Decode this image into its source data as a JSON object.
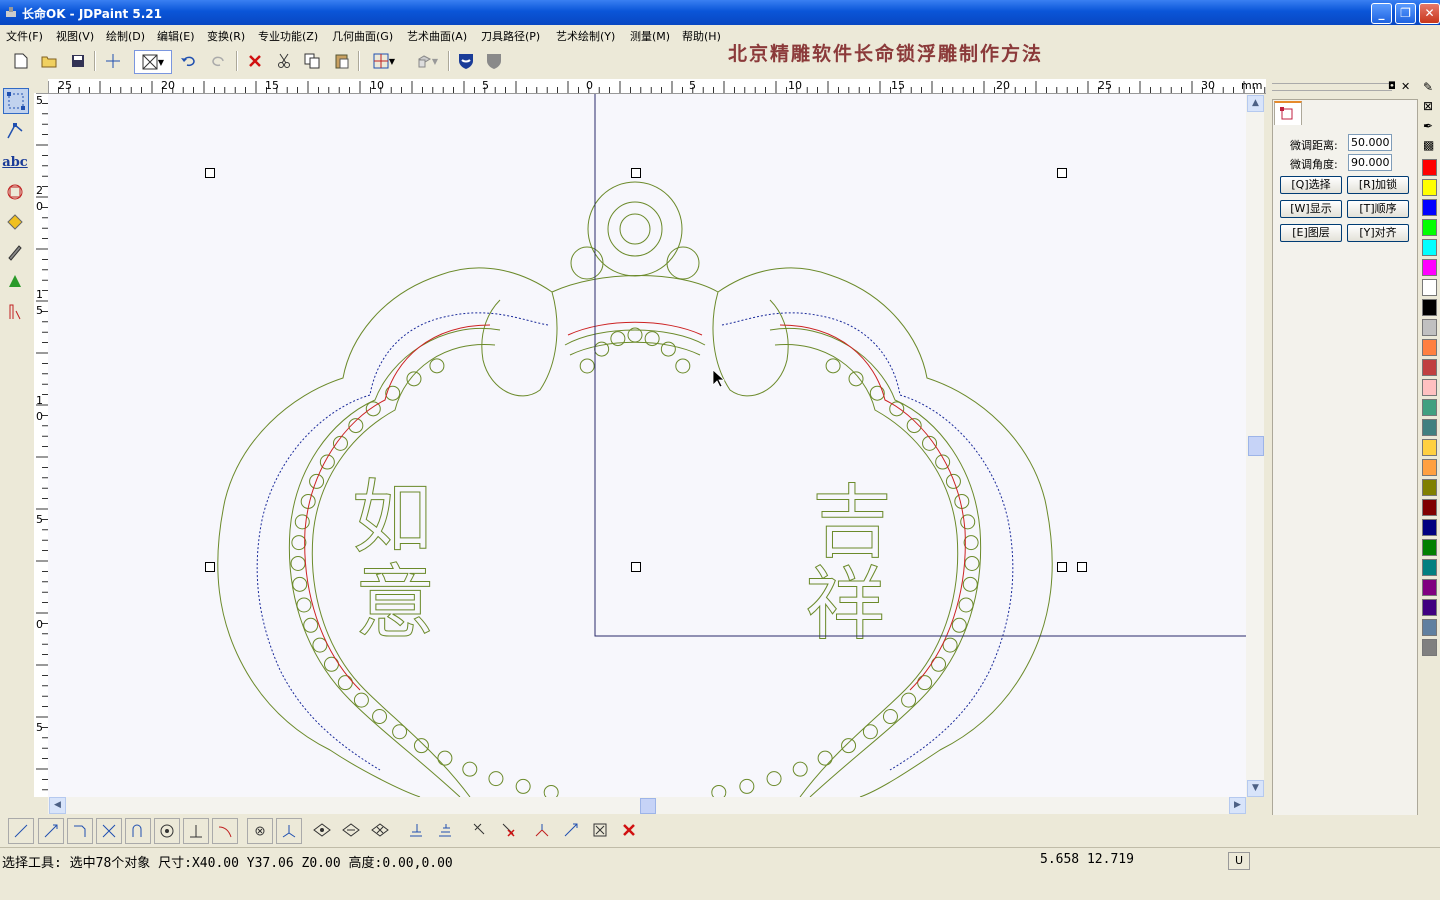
{
  "window": {
    "title": "长命OK - JDPaint 5.21",
    "minimize": "_",
    "maximize": "❐",
    "close": "✕"
  },
  "menu": [
    "文件(F)",
    "视图(V)",
    "绘制(D)",
    "编辑(E)",
    "变换(R)",
    "专业功能(Z)",
    "几何曲面(G)",
    "艺术曲面(A)",
    "刀具路径(P)",
    "艺术绘制(Y)",
    "测量(M)",
    "帮助(H)"
  ],
  "headline": "北京精雕软件长命锁浮雕制作方法",
  "ruler": {
    "h_labels": [
      "25",
      "20",
      "15",
      "10",
      "5",
      "0",
      "5",
      "10",
      "15",
      "20",
      "25",
      "30"
    ],
    "unit": "mm",
    "v_labels": [
      "5",
      "2\n0",
      "1\n5",
      "1\n0",
      "5",
      "0",
      "5"
    ]
  },
  "panel": {
    "dist_label": "微调距离:",
    "dist_value": "50.000",
    "angle_label": "微调角度:",
    "angle_value": "90.000",
    "buttons": [
      "[Q]选择",
      "[R]加锁",
      "[W]显示",
      "[T]顺序",
      "[E]图层",
      "[Y]对齐"
    ]
  },
  "canvas_text": {
    "left_1": "如",
    "left_2": "意",
    "right_1": "吉",
    "right_2": "祥"
  },
  "palette": [
    "#ff0000",
    "#ffff00",
    "#0000ff",
    "#00ff00",
    "#00ffff",
    "#ff00ff",
    "#ffffff",
    "#000000",
    "#c0c0c0",
    "#ff8040",
    "#c04040",
    "#ffc0c0",
    "#40a080",
    "#408080",
    "#ffd040",
    "#ffa040",
    "#808000",
    "#800000",
    "#000080",
    "#008000",
    "#008080",
    "#800080",
    "#400080",
    "#6080a0",
    "#808080"
  ],
  "colors": {
    "curve": "#6b8a2a",
    "dotted": "#1a2a9a",
    "accent": "#cc2222",
    "frame": "#2a2a6a"
  },
  "status": {
    "text": "选择工具: 选中78个对象 尺寸:X40.00 Y37.06 Z0.00 高度:0.00,0.00",
    "coords": "5.658 12.719",
    "unit_btn": "U"
  }
}
